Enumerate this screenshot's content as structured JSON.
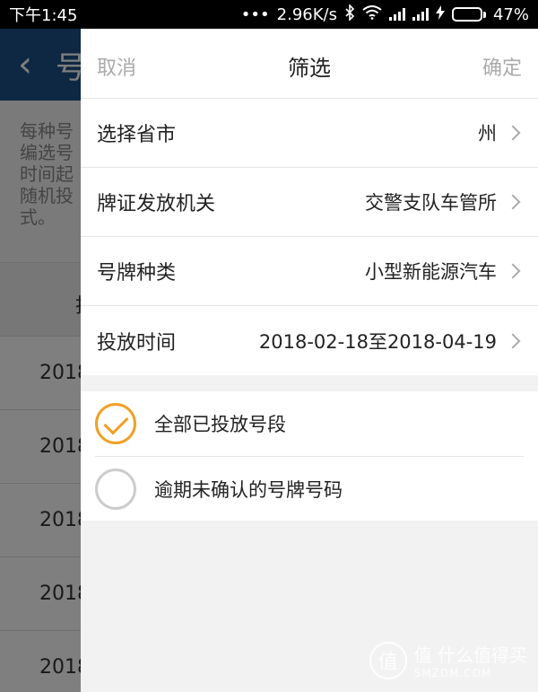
{
  "status_bar": {
    "time": "下午1:45",
    "dots": "•••",
    "speed": "2.96K/s",
    "battery_text": "47%",
    "battery_level": 0.47,
    "icons": [
      "bluetooth-icon",
      "wifi-icon",
      "signal-icon",
      "signal-icon",
      "charging-icon",
      "battery-icon"
    ]
  },
  "background_page": {
    "back_icon": "‹",
    "title_visible": "号",
    "description_lines": [
      "每种号",
      "编选号",
      "时间起",
      "随机投",
      "式。"
    ],
    "column_head": "投",
    "rows": [
      "2018",
      "2018",
      "2018",
      "2018",
      "2018"
    ]
  },
  "drawer": {
    "cancel_label": "取消",
    "title": "筛选",
    "confirm_label": "确定",
    "filters": [
      {
        "label": "选择省市",
        "value": "州"
      },
      {
        "label": "牌证发放机关",
        "value": "交警支队车管所"
      },
      {
        "label": "号牌种类",
        "value": "小型新能源汽车"
      },
      {
        "label": "投放时间",
        "value": "2018-02-18至2018-04-19"
      }
    ],
    "options": [
      {
        "label": "全部已投放号段",
        "checked": true
      },
      {
        "label": "逾期未确认的号牌号码",
        "checked": false
      }
    ]
  },
  "watermark": {
    "line1": "值 什么值得买",
    "line2": "SMZDM.COM",
    "logo_char": "值"
  },
  "colors": {
    "header_blue": "#1c4e86",
    "accent_orange": "#f0a024",
    "battery_green": "#4cd964"
  }
}
